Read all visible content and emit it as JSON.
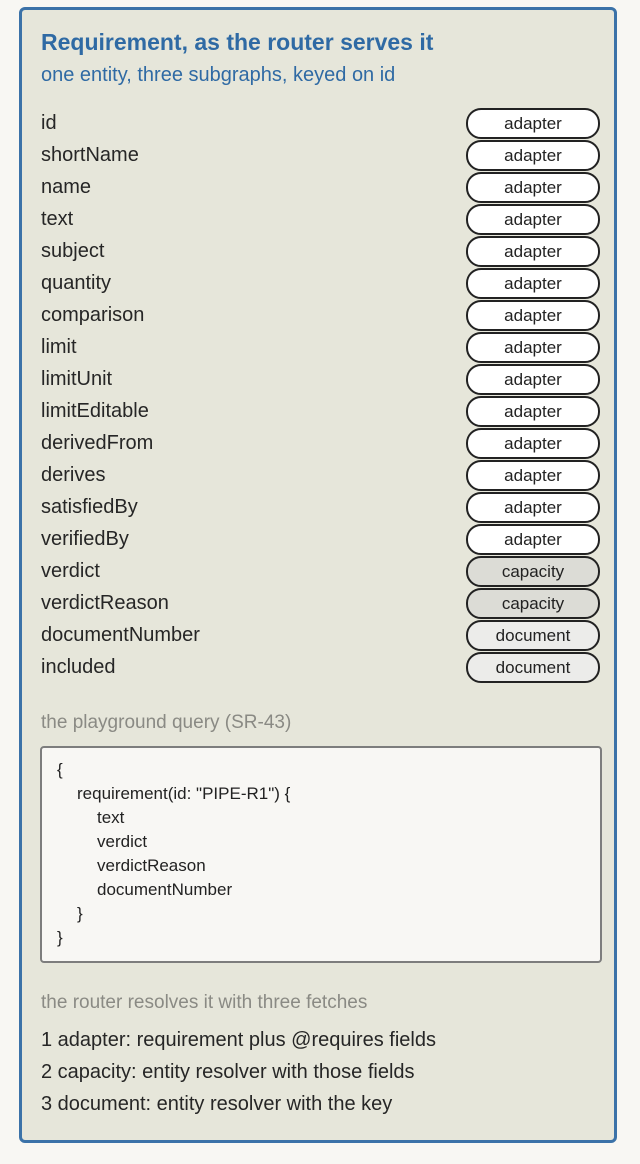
{
  "title": "Requirement, as the router serves it",
  "subtitle": "one entity, three subgraphs, keyed on id",
  "fields": [
    {
      "name": "id",
      "subgraph": "adapter"
    },
    {
      "name": "shortName",
      "subgraph": "adapter"
    },
    {
      "name": "name",
      "subgraph": "adapter"
    },
    {
      "name": "text",
      "subgraph": "adapter"
    },
    {
      "name": "subject",
      "subgraph": "adapter"
    },
    {
      "name": "quantity",
      "subgraph": "adapter"
    },
    {
      "name": "comparison",
      "subgraph": "adapter"
    },
    {
      "name": "limit",
      "subgraph": "adapter"
    },
    {
      "name": "limitUnit",
      "subgraph": "adapter"
    },
    {
      "name": "limitEditable",
      "subgraph": "adapter"
    },
    {
      "name": "derivedFrom",
      "subgraph": "adapter"
    },
    {
      "name": "derives",
      "subgraph": "adapter"
    },
    {
      "name": "satisfiedBy",
      "subgraph": "adapter"
    },
    {
      "name": "verifiedBy",
      "subgraph": "adapter"
    },
    {
      "name": "verdict",
      "subgraph": "capacity"
    },
    {
      "name": "verdictReason",
      "subgraph": "capacity"
    },
    {
      "name": "documentNumber",
      "subgraph": "document"
    },
    {
      "name": "included",
      "subgraph": "document"
    }
  ],
  "query_label": "the playground query (SR-43)",
  "query_lines": [
    {
      "text": "{",
      "indent": 0
    },
    {
      "text": "requirement(id: \"PIPE-R1\") {",
      "indent": 1
    },
    {
      "text": "text",
      "indent": 2
    },
    {
      "text": "verdict",
      "indent": 2
    },
    {
      "text": "verdictReason",
      "indent": 2
    },
    {
      "text": "documentNumber",
      "indent": 2
    },
    {
      "text": "}",
      "indent": 1
    },
    {
      "text": "}",
      "indent": 0
    }
  ],
  "fetch_label": "the router resolves it with three fetches",
  "fetches": [
    "1 adapter: requirement plus @requires fields",
    "2 capacity: entity resolver with those fields",
    "3 document: entity resolver with the key"
  ]
}
